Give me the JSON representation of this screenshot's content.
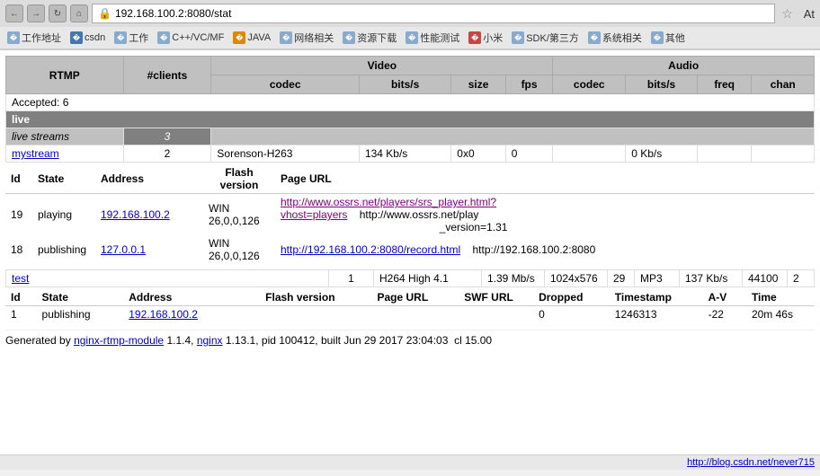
{
  "browser": {
    "address": "192.168.100.2:8080/stat",
    "back_label": "←",
    "forward_label": "→",
    "refresh_label": "↻",
    "home_label": "⌂",
    "star_label": "☆",
    "at_label": "At"
  },
  "bookmarks": [
    {
      "label": "工作地址",
      "icon_type": "folder"
    },
    {
      "label": "csdn",
      "icon_type": "blue"
    },
    {
      "label": "工作",
      "icon_type": "folder"
    },
    {
      "label": "C++/VC/MF",
      "icon_type": "folder"
    },
    {
      "label": "JAVA",
      "icon_type": "orange"
    },
    {
      "label": "网络相关",
      "icon_type": "folder"
    },
    {
      "label": "资源下载",
      "icon_type": "folder"
    },
    {
      "label": "性能测试",
      "icon_type": "folder"
    },
    {
      "label": "小米",
      "icon_type": "red"
    },
    {
      "label": "SDK/第三方",
      "icon_type": "folder"
    },
    {
      "label": "系统相关",
      "icon_type": "folder"
    },
    {
      "label": "其他",
      "icon_type": "folder"
    }
  ],
  "table": {
    "headers": {
      "rtmp": "RTMP",
      "clients": "#clients",
      "video": "Video",
      "audio": "Audio",
      "codec": "codec",
      "bitrate": "bits/s",
      "size": "size",
      "fps": "fps",
      "audio_codec": "codec",
      "audio_bitrate": "bits/s",
      "freq": "freq",
      "chan": "chan"
    },
    "accepted": "Accepted: 6",
    "live_label": "live",
    "live_streams_label": "live streams",
    "live_streams_count": "3",
    "mystream": {
      "name": "mystream",
      "clients": "2",
      "codec": "Sorenson-H263",
      "bitrate": "134 Kb/s",
      "size": "0x0",
      "fps": "0",
      "audio_bitrate": "0 Kb/s"
    },
    "mystream_clients": {
      "headers": {
        "id": "Id",
        "state": "State",
        "address": "Address",
        "flash_version": "Flash\nversion",
        "page_url": "Page URL"
      },
      "rows": [
        {
          "id": "19",
          "state": "playing",
          "address": "192.168.100.2",
          "flash": "WIN\n26,0,0,126",
          "page_url": "http://www.ossrs.net/players/srs_player.html?\nvhost=players",
          "swf_url": "http://www.ossrs.net/play\n_version=1.31"
        },
        {
          "id": "18",
          "state": "publishing",
          "address": "127.0.0.1",
          "flash": "WIN\n26,0,0,126",
          "page_url": "http://192.168.100.2:8080/record.html",
          "swf_url": "http://192.168.100.2:8080"
        }
      ]
    },
    "test": {
      "name": "test",
      "clients": "1",
      "video_codec": "H264",
      "video_profile": "High",
      "video_level": "4.1",
      "bitrate": "1.39 Mb/s",
      "size": "1024x576",
      "fps": "29",
      "audio_codec": "MP3",
      "audio_bitrate": "137 Kb/s",
      "freq": "44100",
      "chan": "2"
    },
    "test_clients": {
      "headers": {
        "id": "Id",
        "state": "State",
        "address": "Address",
        "flash_version": "Flash version",
        "page_url": "Page URL",
        "swf_url": "SWF URL",
        "dropped": "Dropped",
        "timestamp": "Timestamp",
        "av": "A-V",
        "time": "Time"
      },
      "rows": [
        {
          "id": "1",
          "state": "publishing",
          "address": "192.168.100.2",
          "flash": "",
          "page_url": "",
          "swf_url": "",
          "dropped": "0",
          "timestamp": "1246313",
          "av": "-22",
          "time": "20m 46s"
        }
      ]
    }
  },
  "footer": {
    "generated": "Generated by",
    "module_link": "nginx-rtmp-module",
    "version": "1.1.4,",
    "nginx_link": "nginx",
    "nginx_version": "1.13.1, pid 100412, built Jun 29 2017 23:04:03",
    "cl": "cl 15.00"
  },
  "status_bar": {
    "url": "http://blog.csdn.net/never715"
  }
}
